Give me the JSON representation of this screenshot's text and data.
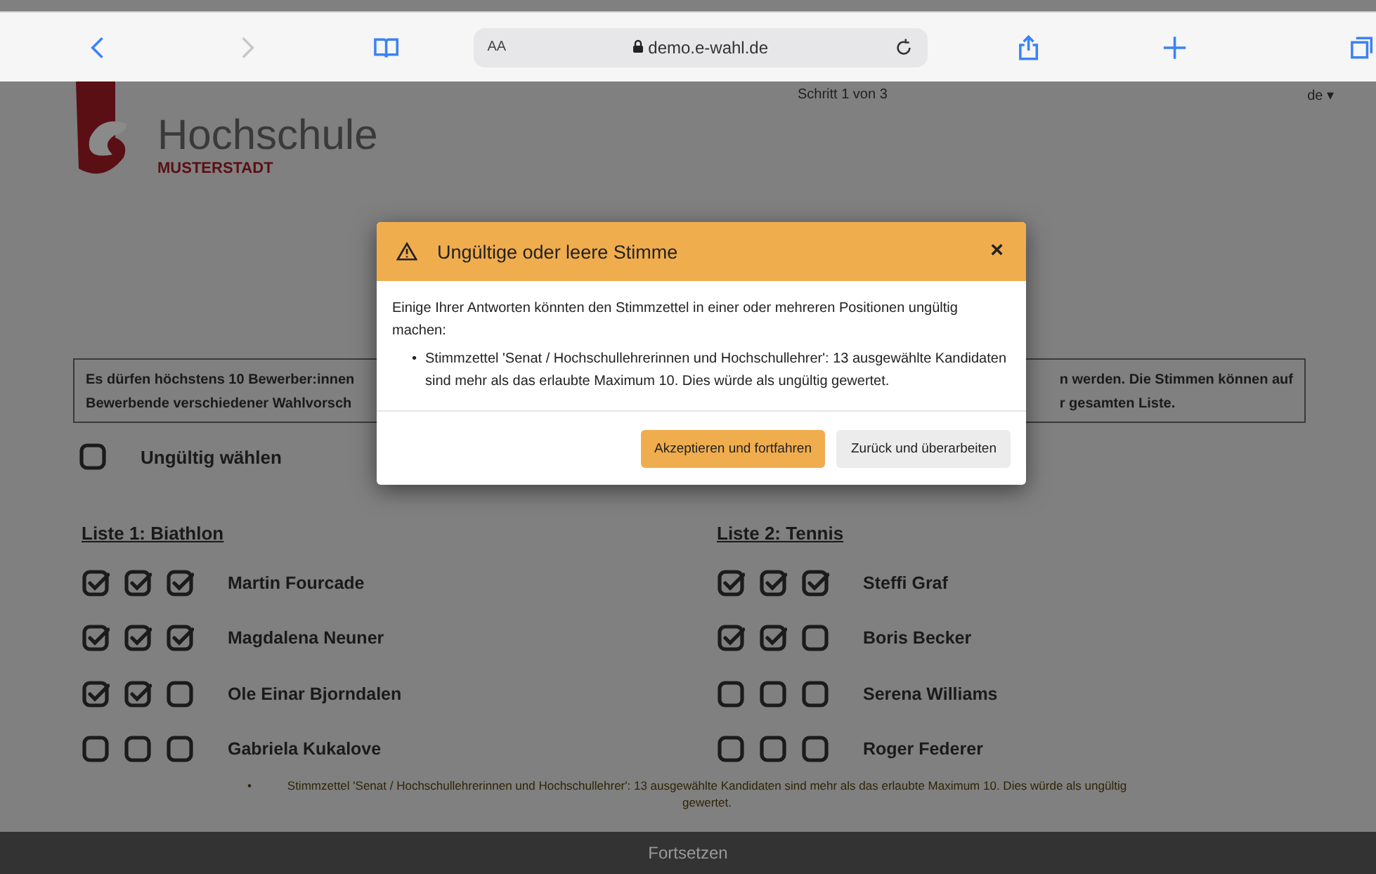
{
  "browser": {
    "text_size": "AA",
    "url": "demo.e-wahl.de"
  },
  "header": {
    "logo_title": "Hochschule",
    "logo_subtitle": "MUSTERSTADT",
    "step": "Schritt 1 von 3",
    "language": "de",
    "language_caret": "▾"
  },
  "info": {
    "left_lines": [
      "Es dürfen höchstens 10 Bewerber:innen",
      "Bewerbende verschiedener Wahlvorsch"
    ],
    "right_lines": [
      "n werden. Die Stimmen können auf",
      "r gesamten Liste."
    ]
  },
  "invalid_vote": {
    "label": "Ungültig wählen",
    "checked": false
  },
  "lists": [
    {
      "title": "Liste 1: Biathlon",
      "candidates": [
        {
          "name": "Martin Fourcade",
          "votes": [
            true,
            true,
            true
          ]
        },
        {
          "name": "Magdalena Neuner",
          "votes": [
            true,
            true,
            true
          ]
        },
        {
          "name": "Ole Einar Bjorndalen",
          "votes": [
            true,
            true,
            false
          ]
        },
        {
          "name": "Gabriela Kukalove",
          "votes": [
            false,
            false,
            false
          ]
        }
      ]
    },
    {
      "title": "Liste 2: Tennis",
      "candidates": [
        {
          "name": "Steffi Graf",
          "votes": [
            true,
            true,
            true
          ]
        },
        {
          "name": "Boris Becker",
          "votes": [
            true,
            true,
            false
          ]
        },
        {
          "name": "Serena Williams",
          "votes": [
            false,
            false,
            false
          ]
        },
        {
          "name": "Roger Federer",
          "votes": [
            false,
            false,
            false
          ]
        }
      ]
    }
  ],
  "error_bullet": "•",
  "error": "Stimmzettel 'Senat / Hochschullehrerinnen und Hochschullehrer': 13 ausgewählte Kandidaten sind mehr als das erlaubte Maximum 10. Dies würde als ungültig gewertet.",
  "footer_button": "Fortsetzen",
  "modal": {
    "title": "Ungültige oder leere Stimme",
    "close": "×",
    "intro": "Einige Ihrer Antworten könnten den Stimmzettel in einer oder mehreren Positionen ungültig machen:",
    "item_bullet": "•",
    "items": [
      "Stimmzettel 'Senat / Hochschullehrerinnen und Hochschullehrer': 13 ausgewählte Kandidaten sind mehr als das erlaubte Maximum 10. Dies würde als ungültig gewertet."
    ],
    "buttons": [
      {
        "label": "Akzeptieren und fortfahren",
        "kind": "primary"
      },
      {
        "label": "Zurück und überarbeiten",
        "kind": "secondary"
      }
    ]
  }
}
